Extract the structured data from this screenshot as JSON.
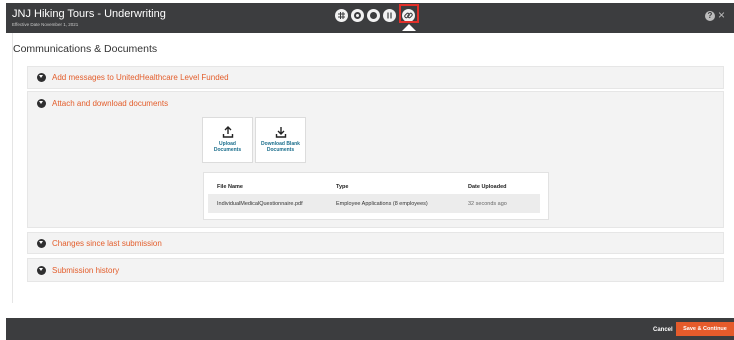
{
  "header": {
    "app_title": "JNJ Hiking Tours - Underwriting",
    "effective_date": "Effective Date November 1, 2021",
    "nav_icons": [
      "grid-icon",
      "settings-circle-icon",
      "record-icon",
      "columns-icon",
      "link-icon"
    ],
    "active_nav": "link-icon",
    "help_icon": "?",
    "close_icon": "×"
  },
  "page": {
    "title": "Communications & Documents"
  },
  "sections": [
    {
      "label": "Add messages to UnitedHealthcare Level Funded",
      "expanded": false
    },
    {
      "label": "Attach and download documents",
      "expanded": true
    },
    {
      "label": "Changes since last submission",
      "expanded": false
    },
    {
      "label": "Submission history",
      "expanded": false
    }
  ],
  "actions": {
    "upload": {
      "line1": "Upload",
      "line2": "Documents"
    },
    "download_blank": {
      "line1": "Download Blank",
      "line2": "Documents"
    }
  },
  "documents": {
    "columns": [
      "File Name",
      "Type",
      "Date Uploaded"
    ],
    "rows": [
      {
        "file_name": "IndividualMedicalQuestionnaire.pdf",
        "type": "Employee Applications (8 employees)",
        "date_uploaded": "32 seconds ago"
      }
    ]
  },
  "footer": {
    "cancel": "Cancel",
    "save": "Save & Continue"
  },
  "colors": {
    "accent": "#e55b2b",
    "header_bg": "#3c3d3f",
    "link_blue": "#1b6e8c",
    "highlight_red": "#e3302a"
  }
}
